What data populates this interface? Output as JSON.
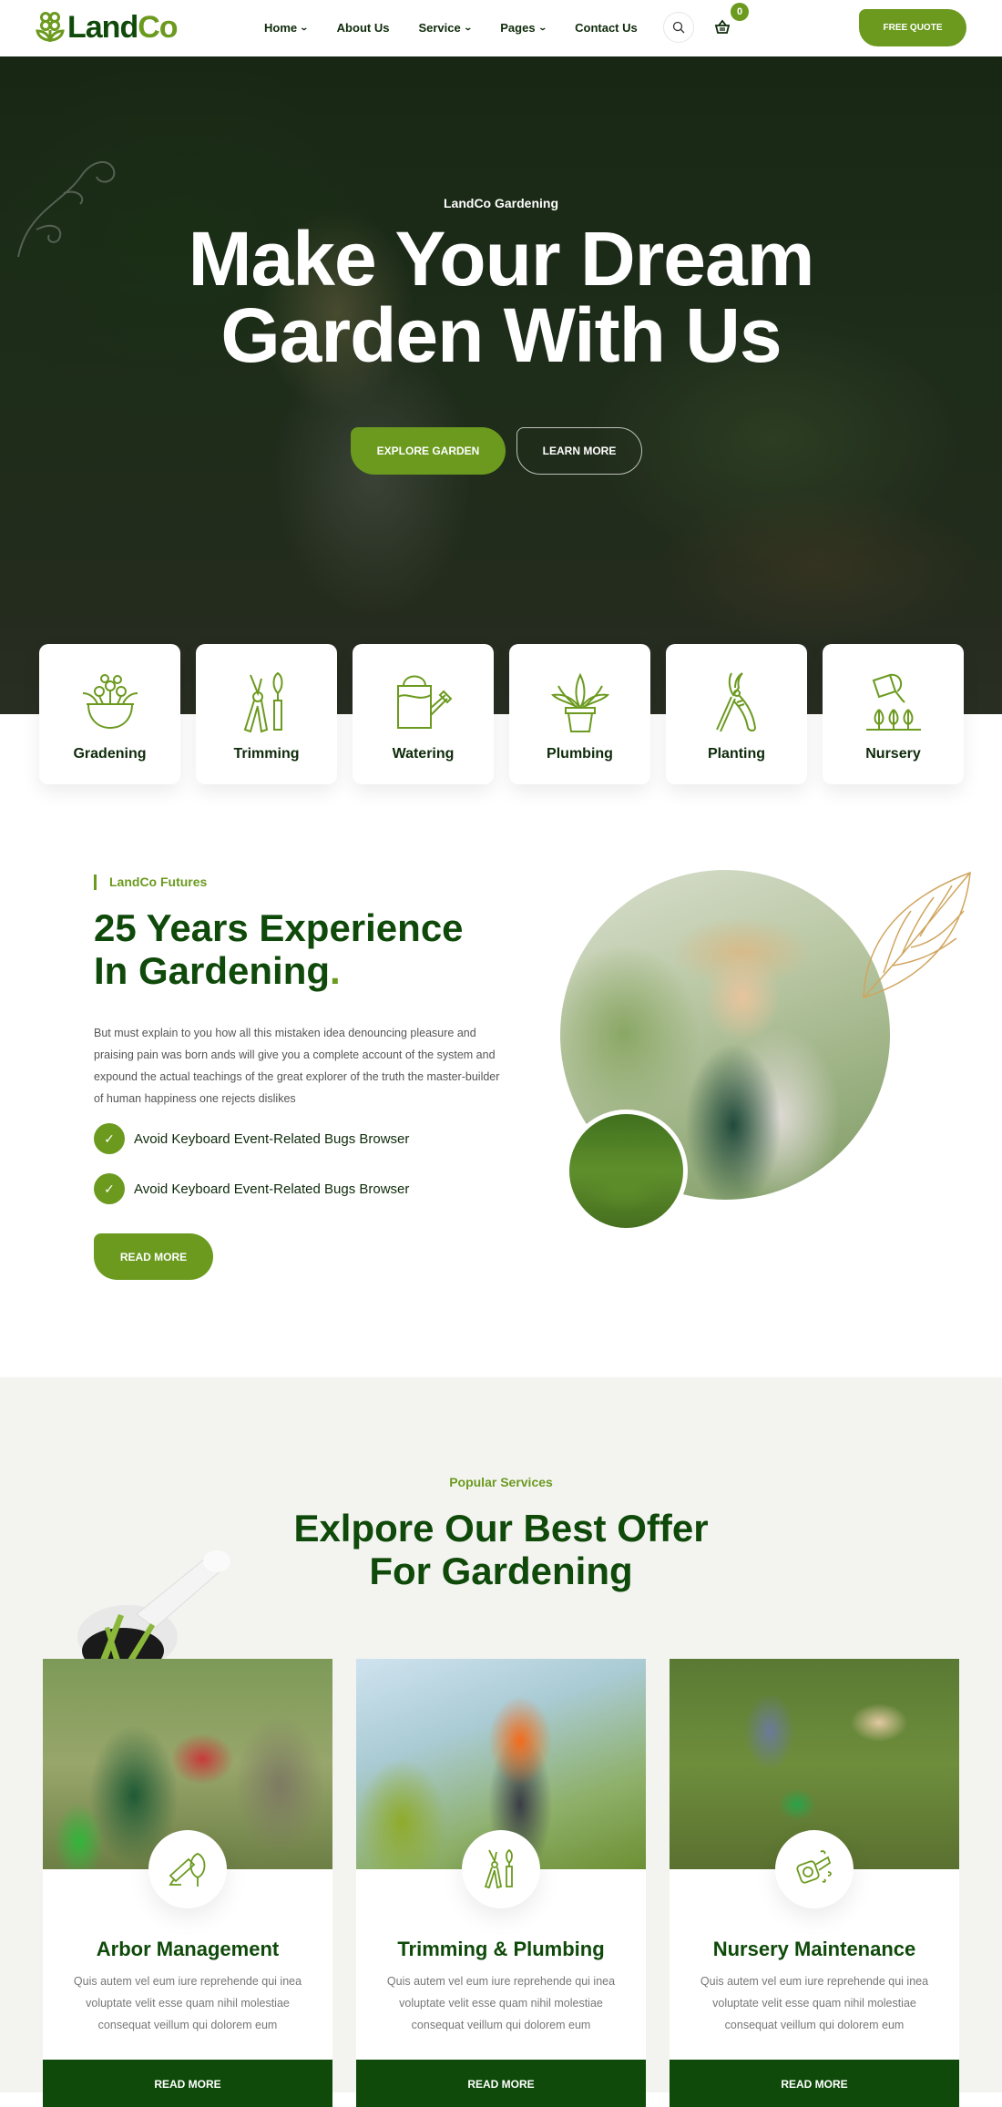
{
  "brand": {
    "name_part1": "Land",
    "name_part2": "Co"
  },
  "colors": {
    "accent": "#6b9a1f",
    "dark_green": "#0f4a0a",
    "section_bg": "#f3f4f0"
  },
  "nav": {
    "items": [
      {
        "label": "Home",
        "dropdown": true
      },
      {
        "label": "About Us",
        "dropdown": false
      },
      {
        "label": "Service",
        "dropdown": true
      },
      {
        "label": "Pages",
        "dropdown": true
      },
      {
        "label": "Contact Us",
        "dropdown": false
      }
    ],
    "search_icon": "search-icon",
    "cart_icon": "basket-icon",
    "cart_count": "0",
    "cta_label": "FREE QUOTE"
  },
  "hero": {
    "eyebrow": "LandCo Gardening",
    "title_line1": "Make Your Dream",
    "title_line2": "Garden With Us",
    "primary_button": "EXPLORE GARDEN",
    "secondary_button": "LEARN MORE"
  },
  "features": [
    {
      "label": "Gradening",
      "icon": "flower-pot-icon"
    },
    {
      "label": "Trimming",
      "icon": "pruner-trowel-icon"
    },
    {
      "label": "Watering",
      "icon": "watering-can-icon"
    },
    {
      "label": "Plumbing",
      "icon": "potted-plant-icon"
    },
    {
      "label": "Planting",
      "icon": "shears-icon"
    },
    {
      "label": "Nursery",
      "icon": "watering-trees-icon"
    }
  ],
  "about": {
    "eyebrow": "LandCo Futures",
    "title_line1": "25 Years Experience",
    "title_line2": "In Gardening",
    "title_dot": ".",
    "text": "But must explain to you how all this mistaken idea denouncing pleasure and praising pain was born ands will give you a complete account of the system and expound the actual teachings of the great explorer of the truth the master-builder of human happiness one rejects dislikes",
    "checks": [
      "Avoid Keyboard Event-Related Bugs Browser",
      "Avoid Keyboard Event-Related Bugs Browser"
    ],
    "button": "READ MORE"
  },
  "services": {
    "eyebrow": "Popular Services",
    "title_line1": "Exlpore Our Best Offer",
    "title_line2": "For Gardening",
    "cards": [
      {
        "title": "Arbor Management",
        "desc": "Quis autem vel eum iure reprehende qui inea voluptate velit esse quam nihil molestiae consequat veillum qui dolorem eum",
        "button": "READ MORE",
        "icon": "hedge-trimmer-icon"
      },
      {
        "title": "Trimming & Plumbing",
        "desc": "Quis autem vel eum iure reprehende qui inea voluptate velit esse quam nihil molestiae consequat veillum qui dolorem eum",
        "button": "READ MORE",
        "icon": "pruner-trowel-icon"
      },
      {
        "title": "Nursery Maintenance",
        "desc": "Quis autem vel eum iure reprehende qui inea voluptate velit esse quam nihil molestiae consequat veillum qui dolorem eum",
        "button": "READ MORE",
        "icon": "leaf-blower-icon"
      }
    ]
  }
}
